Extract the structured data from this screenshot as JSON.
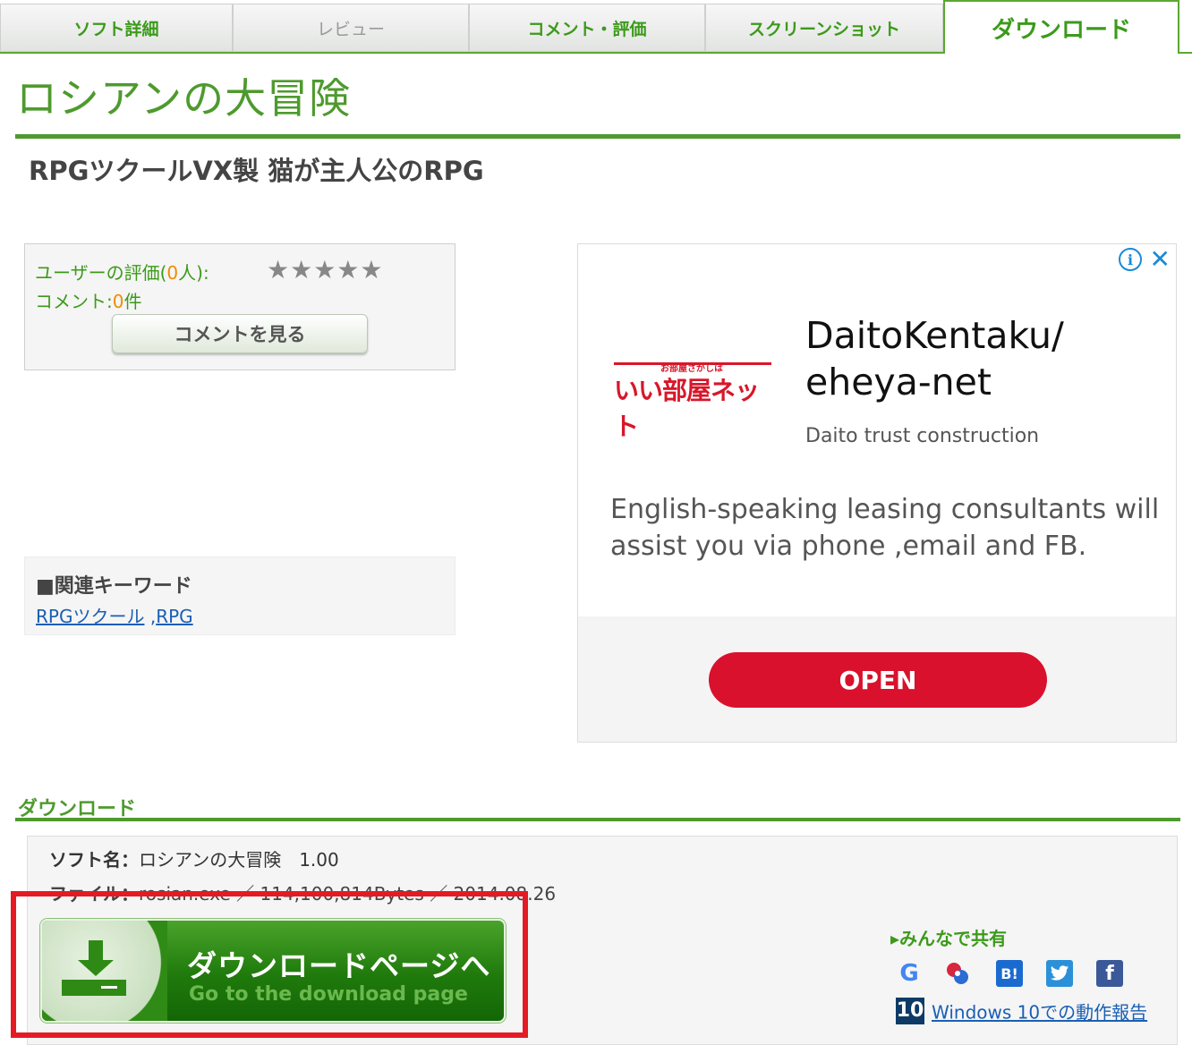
{
  "tabs": [
    {
      "label": "ソフト詳細"
    },
    {
      "label": "レビュー"
    },
    {
      "label": "コメント・評価"
    },
    {
      "label": "スクリーンショット"
    },
    {
      "label": "ダウンロード"
    }
  ],
  "page": {
    "title": "ロシアンの大冒険",
    "subtitle": "RPGツクールVX製 猫が主人公のRPG"
  },
  "rating": {
    "label_prefix": "ユーザーの評価(",
    "count": "0",
    "label_suffix": "人):",
    "stars": "★★★★★",
    "comment_prefix": "コメント:",
    "comment_count": "0",
    "comment_suffix": "件",
    "comment_button": "コメントを見る"
  },
  "keywords": {
    "title": "■関連キーワード",
    "items": [
      "RPGツクール",
      "RPG"
    ],
    "separator": " ,"
  },
  "ad": {
    "logo_small": "お部屋さがしは",
    "logo_big": "いい部屋ネット",
    "headline_1": "DaitoKentaku/",
    "headline_2": "eheya-net",
    "advertiser": "Daito trust construction",
    "body_1": "English-speaking leasing consultants will",
    "body_2": "assist you via phone ,email and FB.",
    "cta": "OPEN",
    "info_icon": "info-icon",
    "close_icon": "close-icon"
  },
  "download": {
    "heading": "ダウンロード",
    "soft_label": "ソフト名：",
    "soft_value": "ロシアンの大冒険　1.00",
    "file_label": "ファイル：",
    "file_value": "rosian.exe ／ 114,100,814Bytes ／ 2014.08.26",
    "button_jp": "ダウンロードページへ",
    "button_en": "Go to the download page",
    "share_title": "みんなで共有",
    "windows_badge": "10",
    "windows_link": "Windows 10での動作報告"
  }
}
